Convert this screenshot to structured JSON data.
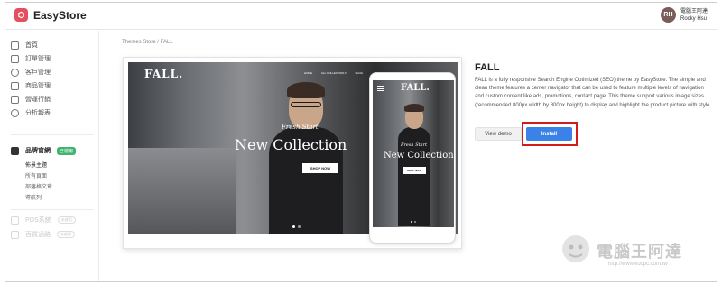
{
  "app": {
    "name": "EasyStore"
  },
  "user": {
    "initials": "RH",
    "shop": "電腦王阿達",
    "name": "Rocky Hsu"
  },
  "sidebar": {
    "items": [
      {
        "label": "首頁",
        "icon": "home-icon"
      },
      {
        "label": "訂單管理",
        "icon": "receipt-icon"
      },
      {
        "label": "客戶管理",
        "icon": "user-icon"
      },
      {
        "label": "商品管理",
        "icon": "box-icon"
      },
      {
        "label": "營運行銷",
        "icon": "megaphone-icon"
      },
      {
        "label": "分析報表",
        "icon": "chart-icon"
      }
    ],
    "brand": {
      "label": "品牌官網",
      "badge": "已啟用"
    },
    "sub_items": [
      "佈景主題",
      "所有頁面",
      "部落格文章",
      "導航列"
    ],
    "muted": [
      {
        "label": "POS系統",
        "badge": "未啟用"
      },
      {
        "label": "百貨通路",
        "badge": "未啟用"
      }
    ]
  },
  "breadcrumb": {
    "root": "Themes Store",
    "sep": "/",
    "current": "FALL"
  },
  "preview": {
    "brand": "FALL.",
    "nav": [
      "HOME",
      "ALL COLLECTION ▾",
      "BLOG"
    ],
    "kicker": "Fresh Start",
    "title": "New Collection",
    "cta": "SHOP NOW",
    "phone_brand": "FALL."
  },
  "theme": {
    "name": "FALL",
    "description": "FALL is a fully responsive Search Engine Optimized (SEO) theme by EasyStore. The simple and clean theme features a center navigator that can be used to feature multiple levels of navigation and custom content like ads, promotions, contact page. This theme support various image sizes (recommended 800px width by 800px height) to display and highlight the product picture with style",
    "demo_label": "View demo",
    "install_label": "Install"
  },
  "watermark": {
    "text": "電腦王阿達",
    "url": "http://www.kocpc.com.tw"
  },
  "colors": {
    "brand": "#e4505f",
    "install": "#3b82e8",
    "highlight": "#d01c1c",
    "badge": "#3fb36f"
  }
}
